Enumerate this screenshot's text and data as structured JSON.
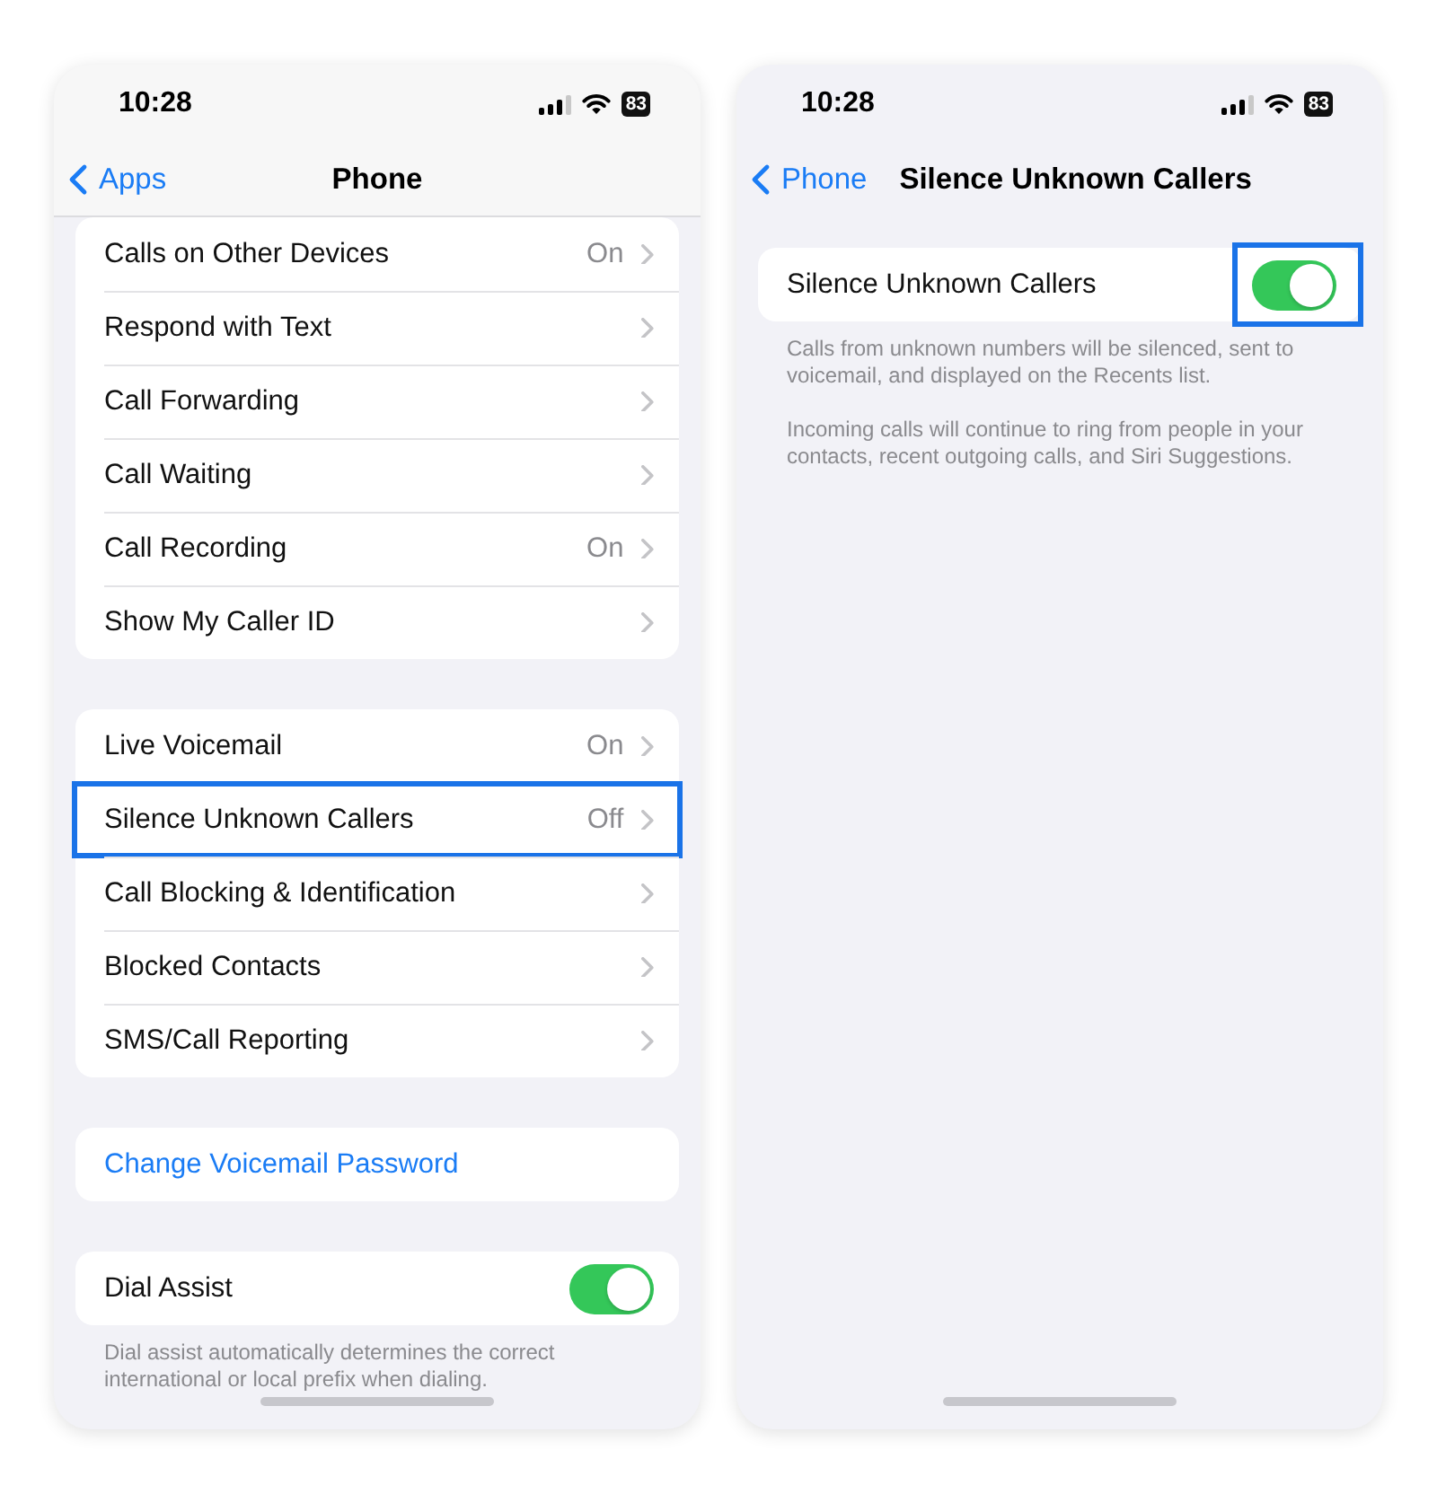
{
  "screens": [
    {
      "status_bar": {
        "time": "10:28",
        "battery": "83"
      },
      "nav": {
        "back": "Apps",
        "title": "Phone",
        "title_bold": false
      },
      "scrolled": true,
      "groups": [
        {
          "rows": [
            {
              "kind": "link",
              "label": "Calls on Other Devices",
              "value": "On",
              "highlighted": false
            },
            {
              "kind": "link",
              "label": "Respond with Text",
              "highlighted": false
            },
            {
              "kind": "link",
              "label": "Call Forwarding",
              "highlighted": false
            },
            {
              "kind": "link",
              "label": "Call Waiting",
              "highlighted": false
            },
            {
              "kind": "link",
              "label": "Call Recording",
              "value": "On",
              "highlighted": false
            },
            {
              "kind": "link",
              "label": "Show My Caller ID",
              "highlighted": false
            }
          ]
        },
        {
          "rows": [
            {
              "kind": "link",
              "label": "Live Voicemail",
              "value": "On",
              "highlighted": false
            },
            {
              "kind": "link",
              "label": "Silence Unknown Callers",
              "value": "Off",
              "highlighted": true
            },
            {
              "kind": "link",
              "label": "Call Blocking & Identification",
              "highlighted": false
            },
            {
              "kind": "link",
              "label": "Blocked Contacts",
              "highlighted": false
            },
            {
              "kind": "link",
              "label": "SMS/Call Reporting",
              "highlighted": false
            }
          ]
        },
        {
          "rows": [
            {
              "kind": "action",
              "label": "Change Voicemail Password",
              "highlighted": false
            }
          ]
        },
        {
          "rows": [
            {
              "kind": "toggle",
              "label": "Dial Assist",
              "on": true,
              "highlighted": false
            }
          ],
          "footer": [
            "Dial assist automatically determines the correct international or local prefix when dialing."
          ]
        }
      ]
    },
    {
      "status_bar": {
        "time": "10:28",
        "battery": "83"
      },
      "nav": {
        "back": "Phone",
        "title": "Silence Unknown Callers",
        "title_bold": true
      },
      "scrolled": false,
      "groups": [
        {
          "rows": [
            {
              "kind": "toggle",
              "label": "Silence Unknown Callers",
              "on": true,
              "highlighted": true
            }
          ],
          "footer": [
            "Calls from unknown numbers will be silenced, sent to voicemail, and displayed on the Recents list.",
            "Incoming calls will continue to ring from people in your contacts, recent outgoing calls, and Siri Suggestions."
          ]
        }
      ]
    }
  ]
}
